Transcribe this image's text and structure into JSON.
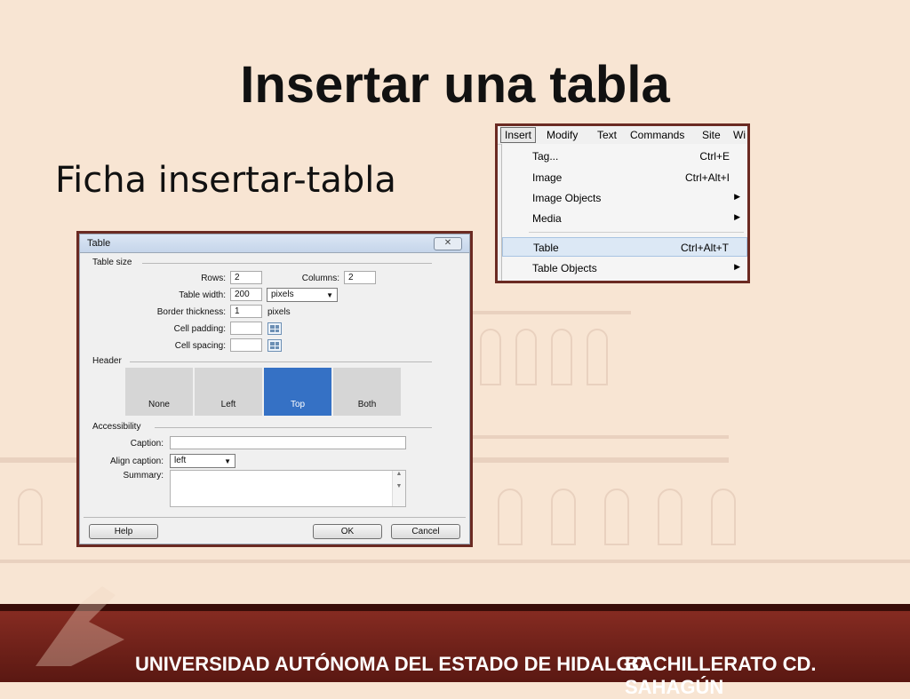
{
  "slide": {
    "title": "Insertar una tabla",
    "subtitle": "Ficha insertar-tabla"
  },
  "dialog": {
    "title": "Table",
    "close_glyph": "✕",
    "table_size_section": "Table size",
    "rows_label": "Rows:",
    "rows_value": "2",
    "columns_label": "Columns:",
    "columns_value": "2",
    "table_width_label": "Table width:",
    "table_width_value": "200",
    "width_unit": "pixels",
    "border_thickness_label": "Border thickness:",
    "border_thickness_value": "1",
    "border_unit": "pixels",
    "cell_padding_label": "Cell padding:",
    "cell_padding_value": "",
    "cell_spacing_label": "Cell spacing:",
    "cell_spacing_value": "",
    "header_section": "Header",
    "header_options": [
      "None",
      "Left",
      "Top",
      "Both"
    ],
    "header_selected": "Top",
    "accessibility_section": "Accessibility",
    "caption_label": "Caption:",
    "caption_value": "",
    "align_caption_label": "Align caption:",
    "align_caption_value": "left",
    "summary_label": "Summary:",
    "help_button": "Help",
    "ok_button": "OK",
    "cancel_button": "Cancel"
  },
  "menu": {
    "menubar": [
      "Insert",
      "Modify",
      "Text",
      "Commands",
      "Site",
      "Wi"
    ],
    "active": "Insert",
    "items": [
      {
        "label": "Tag...",
        "shortcut": "Ctrl+E",
        "submenu": false
      },
      {
        "label": "Image",
        "shortcut": "Ctrl+Alt+I",
        "submenu": false
      },
      {
        "label": "Image Objects",
        "shortcut": "",
        "submenu": true
      },
      {
        "label": "Media",
        "shortcut": "",
        "submenu": true
      },
      {
        "label": "Table",
        "shortcut": "Ctrl+Alt+T",
        "submenu": false,
        "highlighted": true
      },
      {
        "label": "Table Objects",
        "shortcut": "",
        "submenu": true
      }
    ]
  },
  "footer": {
    "left": "UNIVERSIDAD AUTÓNOMA DEL ESTADO DE HIDALGO",
    "right": "BACHILLERATO CD. SAHAGÚN"
  },
  "colors": {
    "background": "#f8e5d3",
    "frame": "#6b2a22",
    "footer": "#7a251c",
    "header_selected": "#3571c5"
  }
}
